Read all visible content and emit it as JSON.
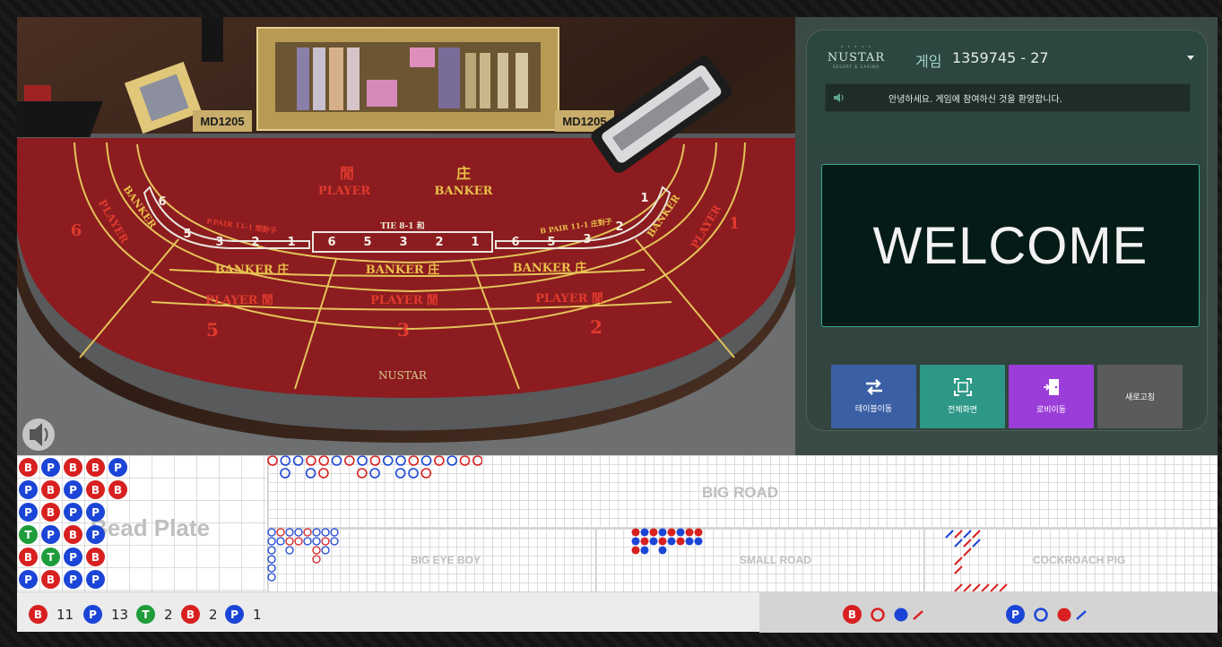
{
  "table": {
    "felt_player": "PLAYER",
    "felt_banker": "BANKER",
    "felt_player_cn": "閒",
    "felt_banker_cn": "庄",
    "table_code": "MD1205",
    "ppair": "P.PAIR  11-1  閒對子",
    "bpair": "B PAIR  11-1  庄對子",
    "tie": "TIE  8-1  和",
    "row_banker": "BANKER 庄",
    "row_player": "PLAYER 閒",
    "seats": [
      "6",
      "5",
      "3",
      "2",
      "1"
    ],
    "felt_logo": "NUSTAR"
  },
  "header": {
    "logo_name": "NUSTAR",
    "logo_sub": "RESORT & CASINO",
    "game_label": "게임",
    "game_number": "1359745 -  27"
  },
  "notice": {
    "message": "안녕하세요. 게임에 참여하신 것을 환영합니다."
  },
  "welcome_text": "WELCOME",
  "buttons": {
    "table_move": "테이블이동",
    "fullscreen": "전체화면",
    "lobby": "로비이동",
    "refresh": "새로고침"
  },
  "roads": {
    "bead_plate_label": "Bead Plate",
    "big_road_label": "BIG ROAD",
    "big_eye_boy_label": "BIG EYE BOY",
    "small_road_label": "SMALL ROAD",
    "cockroach_pig_label": "COCKROACH PIG",
    "bead_plate": [
      [
        "B",
        "P",
        "B",
        "B",
        "P"
      ],
      [
        "P",
        "B",
        "P",
        "B",
        "B"
      ],
      [
        "P",
        "B",
        "P",
        "P",
        ""
      ],
      [
        "T",
        "P",
        "B",
        "P",
        ""
      ],
      [
        "B",
        "T",
        "P",
        "B",
        ""
      ],
      [
        "P",
        "B",
        "P",
        "P",
        ""
      ]
    ]
  },
  "stats": {
    "banker_letter": "B",
    "banker_count": "11",
    "player_letter": "P",
    "player_count": "13",
    "tie_letter": "T",
    "tie_count": "2",
    "banker_pair_letter": "B",
    "banker_pair_count": "2",
    "player_pair_letter": "P",
    "player_pair_count": "1",
    "ask_banker": "B",
    "ask_player": "P"
  },
  "colors": {
    "banker": "#d82020",
    "player": "#1b45d6",
    "tie": "#1e9d3a",
    "felt": "#8c1c1f",
    "panel": "#3a4a44"
  }
}
